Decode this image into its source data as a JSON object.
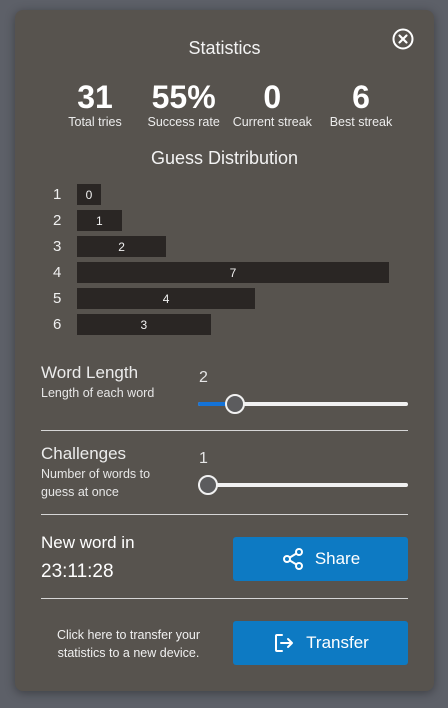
{
  "modal": {
    "title": "Statistics",
    "close_icon": "close-circle-icon"
  },
  "stats": [
    {
      "value": "31",
      "label": "Total tries"
    },
    {
      "value": "55%",
      "label": "Success rate"
    },
    {
      "value": "0",
      "label": "Current streak"
    },
    {
      "value": "6",
      "label": "Best streak"
    }
  ],
  "distribution": {
    "title": "Guess Distribution",
    "max": 7,
    "rows": [
      {
        "guess": "1",
        "count": 0
      },
      {
        "guess": "2",
        "count": 1
      },
      {
        "guess": "3",
        "count": 2
      },
      {
        "guess": "4",
        "count": 7
      },
      {
        "guess": "5",
        "count": 4
      },
      {
        "guess": "6",
        "count": 3
      }
    ]
  },
  "settings": {
    "word_length": {
      "title": "Word Length",
      "description": "Length of each word",
      "value": "2",
      "min": 1,
      "max": 15,
      "fill_fraction": 0.14
    },
    "challenges": {
      "title": "Challenges",
      "description": "Number of words to guess at once",
      "value": "1",
      "min": 1,
      "max": 10,
      "fill_fraction": 0.0
    }
  },
  "countdown": {
    "label": "New word in",
    "time": "23:11:28"
  },
  "share_button": {
    "label": "Share",
    "icon": "share-icon"
  },
  "transfer": {
    "text": "Click here to transfer your statistics to a new device.",
    "button_label": "Transfer",
    "icon": "sign-in-icon"
  },
  "colors": {
    "modal_bg": "#57534e",
    "bar_bg": "#2a2624",
    "button_bg": "#0d7ac3",
    "slider_fill": "#1473d8"
  }
}
